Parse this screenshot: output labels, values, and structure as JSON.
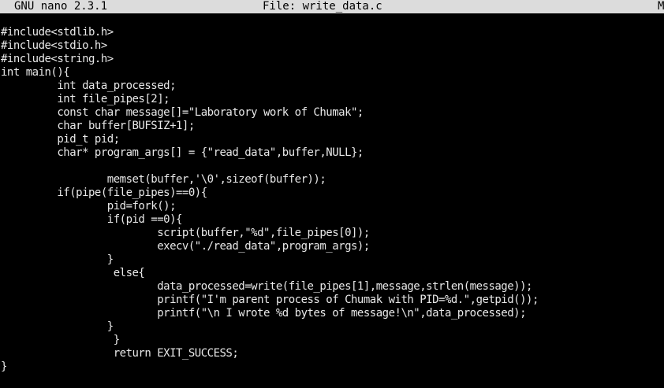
{
  "titlebar": {
    "app_version": "GNU nano 2.3.1",
    "file_label": "File: write_data.c",
    "status_flag": "M"
  },
  "editor": {
    "lines": [
      "#include<stdlib.h>",
      "#include<stdio.h>",
      "#include<string.h>",
      "int main(){",
      "         int data_processed;",
      "         int file_pipes[2];",
      "         const char message[]=\"Laboratory work of Chumak\";",
      "         char buffer[BUFSIZ+1];",
      "         pid_t pid;",
      "         char* program_args[] = {\"read_data\",buffer,NULL};",
      "",
      "                 memset(buffer,'\\0',sizeof(buffer));",
      "         if(pipe(file_pipes)==0){",
      "                 pid=fork();",
      "                 if(pid ==0){",
      "                         script(buffer,\"%d\",file_pipes[0]);",
      "                         execv(\"./read_data\",program_args);",
      "                 }",
      "                  else{",
      "                         data_processed=write(file_pipes[1],message,strlen(message));",
      "                         printf(\"I'm parent process of Chumak with PID=%d.\",getpid());",
      "                         printf(\"\\n I wrote %d bytes of message!\\n\",data_processed);",
      "                 }",
      "                  }",
      "                  return EXIT_SUCCESS;",
      "}"
    ]
  }
}
